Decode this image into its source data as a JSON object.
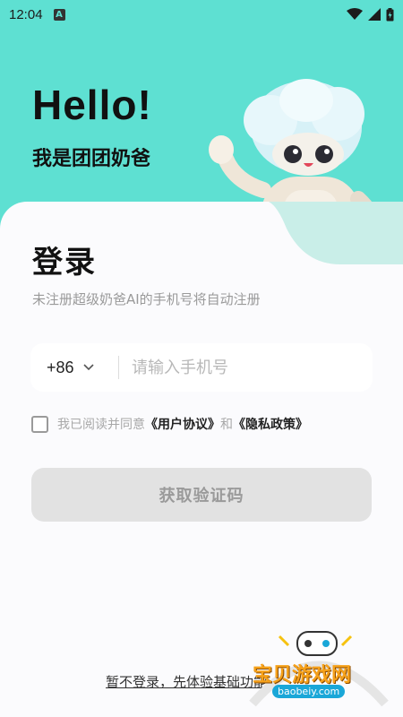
{
  "status_bar": {
    "time": "12:04",
    "notif_letter": "A"
  },
  "hero": {
    "greeting": "Hello!",
    "subtitle": "我是团团奶爸"
  },
  "login": {
    "title": "登录",
    "description": "未注册超级奶爸AI的手机号将自动注册",
    "country_code": "+86",
    "phone_placeholder": "请输入手机号",
    "agree_prefix": "我已阅读并同意",
    "user_agreement": "《用户协议》",
    "and": "和",
    "privacy_policy": "《隐私政策》",
    "get_code_button": "获取验证码",
    "skip_link": "暂不登录，先体验基础功能"
  },
  "watermark": {
    "text": "宝贝游戏网",
    "url": "baobeiy.com"
  },
  "colors": {
    "accent": "#5ee0d2",
    "card": "#fbfbfd",
    "button_disabled": "#e2e2e2"
  }
}
